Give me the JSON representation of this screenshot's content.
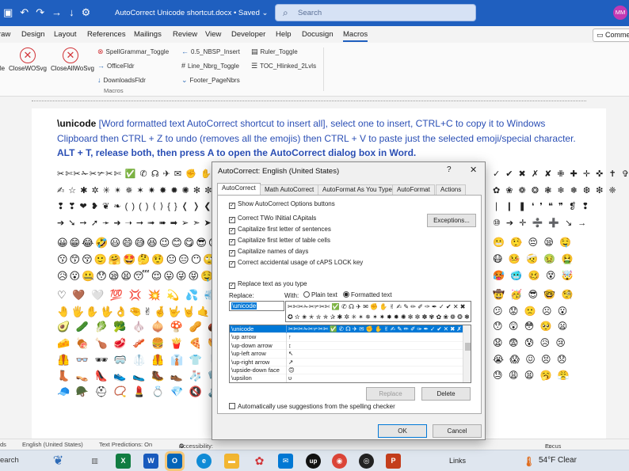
{
  "titlebar": {
    "title": "AutoCorrect Unicode shortcut.docx • Saved ⌄",
    "search_placeholder": "Search",
    "avatar": "MM",
    "icons": [
      "save-icon",
      "undo-icon",
      "redo-icon",
      "forward-icon",
      "download-icon",
      "more-icon"
    ]
  },
  "menu": {
    "items": [
      "raw",
      "Design",
      "Layout",
      "References",
      "Mailings",
      "Review",
      "View",
      "Developer",
      "Help",
      "Docusign",
      "Macros"
    ],
    "active": "Macros",
    "comments": "Comme"
  },
  "ribbon": {
    "big_buttons": [
      "le",
      "CloseWOSvg",
      "CloseAllWoSvg"
    ],
    "col1": [
      "SpellGrammar_Toggle",
      "OfficeFldr",
      "DownloadsFldr"
    ],
    "col2": [
      "0.5_NBSP_Insert",
      "Line_Nbrg_Toggle",
      "Footer_PageNbrs"
    ],
    "col3": [
      "Ruler_Toggle",
      "TOC_Hlinked_2Lvls"
    ],
    "group": "Macros"
  },
  "doc": {
    "keyword": "\\unicode",
    "para1": " [Word formatted text AutoCorrect shortcut to insert all], select one to insert, CTRL+C to copy it to Windows Clipboard then CTRL + Z to undo (removes all the emojis) then CTRL + V to paste just the selected emoji/special character. ",
    "para_strong": "ALT + T, release both, then press A to open the AutoCorrect dialog box in Word.",
    "rows": [
      "✂✄✂✁✂✃✂✄ ✅ ✆ ☊ ✈ ✉ ✊ ✋",
      "✍ ☆ ✱ ✲ ✳ ✴ ✵ ✶ ✷ ✸ ✹ ✺ ✻ ✼ ✽",
      "❢ ❣ ❤ ❥ ❦ ❧ ( ) ( ) ⟨ ⟩ { } ❬ ❭ ❮ ❯",
      "➔ ➘ ➙ ➚ ➛ ➜ ➝ ➞ ➟ ➠ ➡ ➢ ➣ ➤ ➥",
      "😀😁😂🤣😃😄😅😆😉😊😋😎😍😘",
      "😗😙😚🙂🤗🤩🤔🤨😐😑😶🙄😏😣",
      "😥😮🤐😯😪😫😴😌😛😜😝🤤😒😓",
      "♡ 🤎 🤍 💯 💢 💥 💫 💦 💨 🕳 💬 💭 💤 👋",
      "🤚🖐✋🖖👌🤏✌🤞🤟🤘🤙👈👉👆",
      "🥑 🥒 🥬 🥦 🧄 🧅 🍄 🥜 🌰 🍞 🥐 🥖",
      "🧀 🍖 🍗 🥩 🥓 🍔 🍟 🍕 🌭 🥪 🌮 🌯",
      "🦺 👓 🕶 🥽 🥼 🦺 👔 👕 👖 🧣 🧤 🧥",
      "👢 👡 👠 👟 🥿 🥾 👞 🧦 🧤 🧣 🎩 🧢",
      "🧢 🪖 ⛑ 📿 💄 💍 💎 🔇 🔈 🔉 🔊 📢"
    ],
    "right_rows": [
      "✓ ✔ ✖ ✗ ✘ ✙ ✚ ✛ ✜ ✝ ✞",
      "✿ ❀ ❁ ❂ ❃ ❄ ❅ ❆ ❇ ❈",
      "❘ ❙ ❚ ❛ ❜ ❝ ❞ ❡ ❢",
      "⑩ ➔ ✛ ➗ ➕ ↘ →",
      "😬 🤥 😔 😪 🤤",
      "😷 🤒 🤕 🤢 🤮",
      "🥵 🥶 🥴 😵 🤯",
      "🤠 🥳 😎 🤓 🧐",
      "😕 😟 🙁 ☹ 😮",
      "😯 😲 😳 🥺 😦",
      "😧 😨 😰 😥 😢",
      "😭 😱 😖 😣 😞",
      "😓 😩 😫 🥱 😤"
    ]
  },
  "status": {
    "left": "ds",
    "language": "English (United States)",
    "predictions": "Text Predictions: On",
    "accessibility": "Accessibility: Good to go",
    "focus": "Focus"
  },
  "taskbar": {
    "search": "earch",
    "links": "Links",
    "weather": "54°F  Clear"
  },
  "dialog": {
    "title": "AutoCorrect: English (United States)",
    "help": "?",
    "close": "✕",
    "tabs": [
      "AutoCorrect",
      "Math AutoCorrect",
      "AutoFormat As You Type",
      "AutoFormat",
      "Actions"
    ],
    "options": [
      {
        "label": "Show AutoCorrect Options buttons",
        "checked": true
      },
      {
        "label": "Correct TWo INitial CApitals",
        "checked": true
      },
      {
        "label": "Capitalize first letter of sentences",
        "checked": true
      },
      {
        "label": "Capitalize first letter of table cells",
        "checked": true
      },
      {
        "label": "Capitalize names of days",
        "checked": true
      },
      {
        "label": "Correct accidental usage of cAPS LOCK key",
        "checked": true
      }
    ],
    "exceptions": "Exceptions...",
    "replace_as_you_type": "Replace text as you type",
    "replace_label": "Replace:",
    "with_label": "With:",
    "plain_text": "Plain text",
    "formatted_text": "Formatted text",
    "formatted_selected": true,
    "replace_value": "\\unicode",
    "with_line1": "✂✄✂✁✂✃✂✄ ✅ ✆ ☊ ✈ ✉ ✊ ✋ ✌ ✍ ✎ ✏ ✐ ✑ ✒ ✓ ✔ ✕ ✖",
    "with_line2": "✪ ✫ ✬ ✭ ✮ ✯ ✰ ✱ ✲ ✳ ✴ ✵ ✶ ✷ ✸ ✹ ✺ ✻ ✼ ✽ ✾ ✿ ❀ ❁ ❂ ❃",
    "entries": [
      {
        "key": "\\unicode",
        "value": "✂✄✂✁✂✃✂✄ ✅ ✆ ☊ ✈ ✉ ✊ ✋ ✌ ✍ ✎ ✏ ✐ ✑ ✒ ✓ ✔ ✕ ✖ ✗ ✘ ✙",
        "selected": true
      },
      {
        "key": "\\up arrow",
        "value": "↑"
      },
      {
        "key": "\\up-down arrow",
        "value": "↕"
      },
      {
        "key": "\\up-left arrow",
        "value": "↖"
      },
      {
        "key": "\\up-right arrow",
        "value": "↗"
      },
      {
        "key": "\\upside-down face",
        "value": "🙃"
      },
      {
        "key": "\\upsilon",
        "value": "υ"
      }
    ],
    "replace_btn": "Replace",
    "delete_btn": "Delete",
    "auto_suggest": "Automatically use suggestions from the spelling checker",
    "ok": "OK",
    "cancel": "Cancel"
  }
}
